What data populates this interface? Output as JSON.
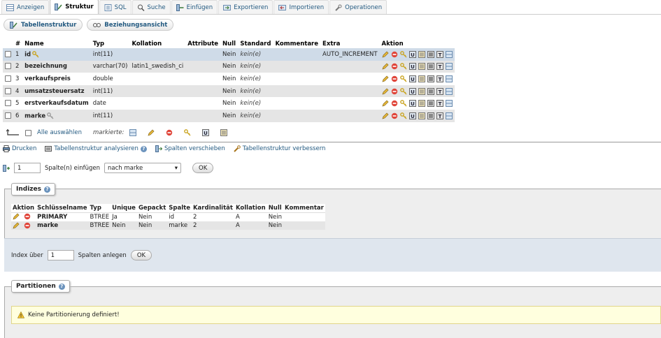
{
  "tabs": [
    {
      "label": "Anzeigen",
      "icon": "table-browse-icon"
    },
    {
      "label": "Struktur",
      "icon": "structure-icon"
    },
    {
      "label": "SQL",
      "icon": "sql-icon"
    },
    {
      "label": "Suche",
      "icon": "search-icon"
    },
    {
      "label": "Einfügen",
      "icon": "insert-icon"
    },
    {
      "label": "Exportieren",
      "icon": "export-icon"
    },
    {
      "label": "Importieren",
      "icon": "import-icon"
    },
    {
      "label": "Operationen",
      "icon": "wrench-icon"
    }
  ],
  "active_tab": "Struktur",
  "subtabs": {
    "structure": "Tabellenstruktur",
    "relations": "Beziehungsansicht"
  },
  "structure": {
    "headers": {
      "num": "#",
      "name": "Name",
      "type": "Typ",
      "collation": "Kollation",
      "attributes": "Attribute",
      "null": "Null",
      "default": "Standard",
      "comments": "Kommentare",
      "extra": "Extra",
      "action": "Aktion"
    },
    "rows": [
      {
        "num": "1",
        "name": "id",
        "type": "int(11)",
        "collation": "",
        "attributes": "",
        "null": "Nein",
        "default": "kein(e)",
        "comments": "",
        "extra": "AUTO_INCREMENT"
      },
      {
        "num": "2",
        "name": "bezeichnung",
        "type": "varchar(70)",
        "collation": "latin1_swedish_ci",
        "attributes": "",
        "null": "Nein",
        "default": "kein(e)",
        "comments": "",
        "extra": ""
      },
      {
        "num": "3",
        "name": "verkaufspreis",
        "type": "double",
        "collation": "",
        "attributes": "",
        "null": "Nein",
        "default": "kein(e)",
        "comments": "",
        "extra": ""
      },
      {
        "num": "4",
        "name": "umsatzsteuersatz",
        "type": "int(11)",
        "collation": "",
        "attributes": "",
        "null": "Nein",
        "default": "kein(e)",
        "comments": "",
        "extra": ""
      },
      {
        "num": "5",
        "name": "erstverkaufsdatum",
        "type": "date",
        "collation": "",
        "attributes": "",
        "null": "Nein",
        "default": "kein(e)",
        "comments": "",
        "extra": ""
      },
      {
        "num": "6",
        "name": "marke",
        "type": "int(11)",
        "collation": "",
        "attributes": "",
        "null": "Nein",
        "default": "kein(e)",
        "comments": "",
        "extra": ""
      }
    ]
  },
  "bulk": {
    "select_all": "Alle auswählen",
    "with_selected": "markierte:"
  },
  "links": {
    "print": "Drucken",
    "analyze": "Tabellenstruktur analysieren",
    "move_columns": "Spalten verschieben",
    "improve": "Tabellenstruktur verbessern"
  },
  "insert": {
    "count": "1",
    "label": "Spalte(n) einfügen",
    "position": "nach marke",
    "ok": "OK"
  },
  "indexes": {
    "legend": "Indizes",
    "headers": [
      "Aktion",
      "Schlüsselname",
      "Typ",
      "Unique",
      "Gepackt",
      "Spalte",
      "Kardinalität",
      "Kollation",
      "Null",
      "Kommentar"
    ],
    "rows": [
      {
        "key": "PRIMARY",
        "type": "BTREE",
        "unique": "Ja",
        "packed": "Nein",
        "column": "id",
        "cardinality": "2",
        "collation": "A",
        "null": "Nein",
        "comment": ""
      },
      {
        "key": "marke",
        "type": "BTREE",
        "unique": "Nein",
        "packed": "Nein",
        "column": "marke",
        "cardinality": "2",
        "collation": "A",
        "null": "Nein",
        "comment": ""
      }
    ],
    "create_prefix": "Index über",
    "create_count": "1",
    "create_suffix": "Spalten anlegen",
    "ok": "OK"
  },
  "partitions": {
    "legend": "Partitionen",
    "warning": "Keine Partitionierung definiert!"
  }
}
